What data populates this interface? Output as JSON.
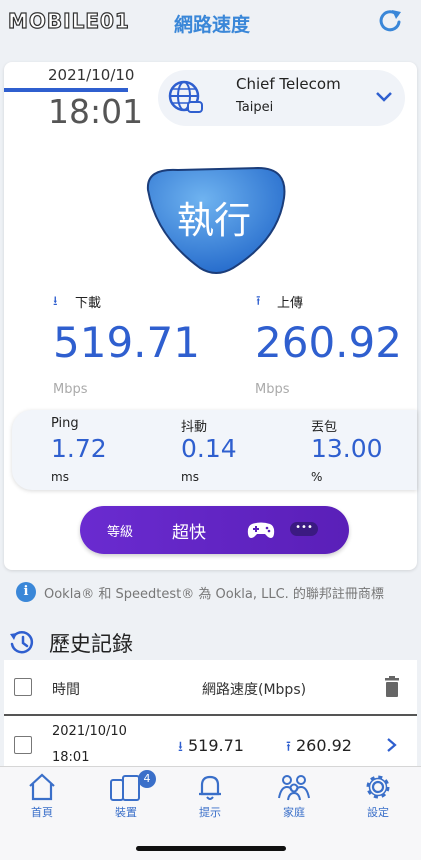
{
  "header": {
    "logo_text": "MOBILE01",
    "title": "網路速度",
    "refresh_icon": "refresh-icon"
  },
  "result": {
    "date": "2021/10/10",
    "time": "18:01",
    "server_name": "Chief Telecom",
    "server_city": "Taipei",
    "go_label": "執行",
    "download_label": "下載",
    "upload_label": "上傳",
    "download_value": "519.71",
    "upload_value": "260.92",
    "download_unit": "Mbps",
    "upload_unit": "Mbps",
    "ping_label": "Ping",
    "ping_value": "1.72",
    "ping_unit": "ms",
    "jitter_label": "抖動",
    "jitter_value": "0.14",
    "jitter_unit": "ms",
    "loss_label": "丟包",
    "loss_value": "13.00",
    "loss_unit": "%",
    "grade_label": "等級",
    "grade_value": "超快",
    "grade_dots": "•••"
  },
  "info": {
    "icon": "i",
    "text": "Ookla® 和 Speedtest® 為 Ookla, LLC. 的聯邦註冊商標"
  },
  "history": {
    "title": "歷史記錄",
    "col_time": "時間",
    "col_speed": "網路速度(Mbps)",
    "rows": [
      {
        "date": "2021/10/10",
        "time": "18:01",
        "download": "519.71",
        "upload": "260.92"
      }
    ]
  },
  "tabs": [
    {
      "label": "首頁",
      "icon": "home-icon"
    },
    {
      "label": "裝置",
      "icon": "devices-icon",
      "badge": "4"
    },
    {
      "label": "提示",
      "icon": "bell-icon"
    },
    {
      "label": "家庭",
      "icon": "family-icon"
    },
    {
      "label": "設定",
      "icon": "gear-icon"
    }
  ],
  "colors": {
    "accent": "#2f5fcf",
    "title_blue": "#3a87d8",
    "grade_purple": "#6a2bd0"
  }
}
